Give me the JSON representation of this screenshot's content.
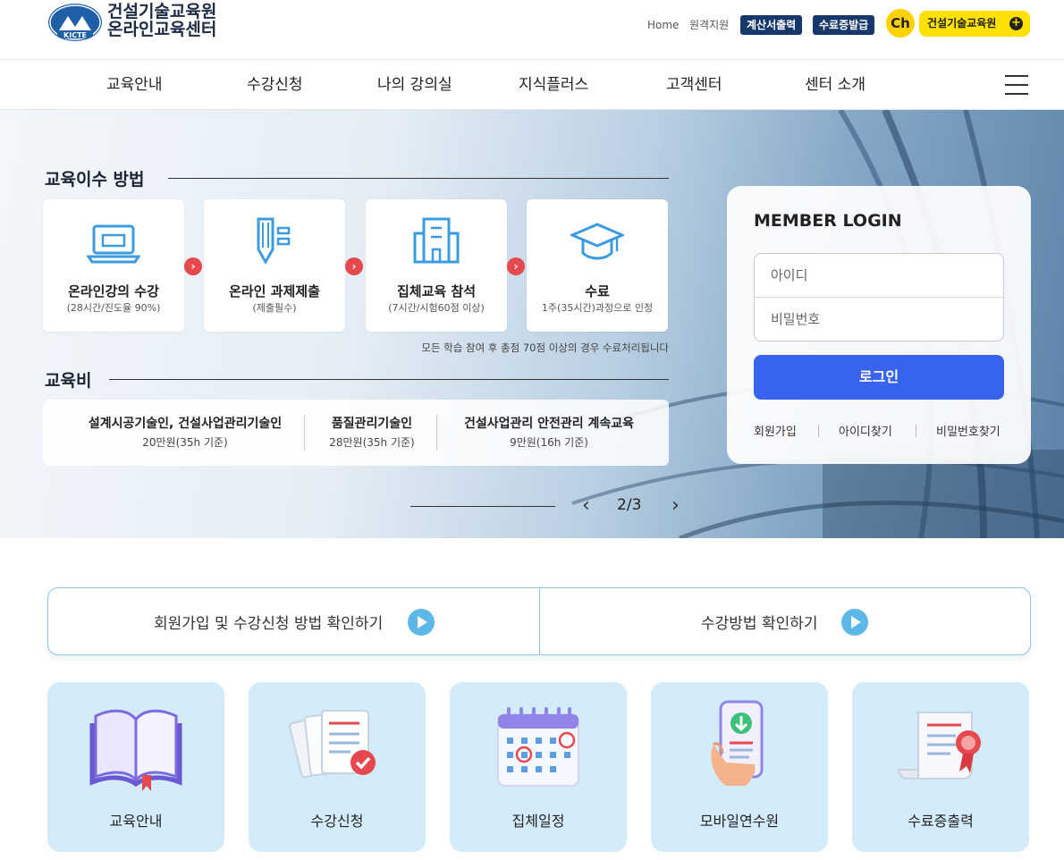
{
  "header": {
    "logo_badge": "KICTE",
    "logo_line1": "건설기술교육원",
    "logo_line2": "온라인교육센터",
    "util_home": "Home",
    "util_remote": "원격지원",
    "util_invoice": "계산서출력",
    "util_cert": "수료증발급",
    "channel_icon": "Ch",
    "channel_label": "건설기술교육원",
    "channel_plus": "+"
  },
  "gnb": {
    "items": [
      "교육안내",
      "수강신청",
      "나의 강의실",
      "지식플러스",
      "고객센터",
      "센터 소개"
    ]
  },
  "hero": {
    "steps_title": "교육이수 방법",
    "steps": [
      {
        "title": "온라인강의 수강",
        "desc": "(28시간/진도율 90%)",
        "icon": "laptop-icon"
      },
      {
        "title": "온라인 과제제출",
        "desc": "(제출필수)",
        "icon": "pencil-doc-icon"
      },
      {
        "title": "집체교육 참석",
        "desc": "(7시간/시험60점 이상)",
        "icon": "building-icon"
      },
      {
        "title": "수료",
        "desc": "1주(35시간)과정으로 인정",
        "icon": "graduation-cap-icon"
      }
    ],
    "step_arrow": "›",
    "note": "모든 학습 참여 후 총점 70점 이상의 경우 수료처리됩니다",
    "fee_title": "교육비",
    "fees": [
      {
        "name": "설계시공기술인, 건설사업관리기술인",
        "price": "20만원(35h 기준)"
      },
      {
        "name": "품질관리기술인",
        "price": "28만원(35h 기준)"
      },
      {
        "name": "건설사업관리 안전관리 계속교육",
        "price": "9만원(16h 기준)"
      }
    ],
    "pager": {
      "current": "2",
      "separator": "/",
      "total": "3",
      "prev": "‹",
      "next": "›",
      "progress": 0.6667
    }
  },
  "login": {
    "title": "MEMBER LOGIN",
    "id_placeholder": "아이디",
    "pw_placeholder": "비밀번호",
    "submit": "로그인",
    "links": [
      "회원가입",
      "아이디찾기",
      "비밀번호찾기"
    ]
  },
  "guides": [
    {
      "label": "회원가입 및 수강신청 방법 확인하기"
    },
    {
      "label": "수강방법 확인하기"
    }
  ],
  "quick_menu": [
    {
      "label": "교육안내",
      "icon": "open-book-icon"
    },
    {
      "label": "수강신청",
      "icon": "application-docs-icon"
    },
    {
      "label": "집체일정",
      "icon": "calendar-icon"
    },
    {
      "label": "모바일연수원",
      "icon": "mobile-download-icon"
    },
    {
      "label": "수료증출력",
      "icon": "certificate-icon"
    }
  ],
  "colors": {
    "primary_navy": "#17386b",
    "login_blue": "#3763ee",
    "kakao_yellow": "#ffe100",
    "accent_red": "#e5484d",
    "quick_card_bg": "#d4ebf9",
    "guide_border": "#8ec5e8"
  }
}
